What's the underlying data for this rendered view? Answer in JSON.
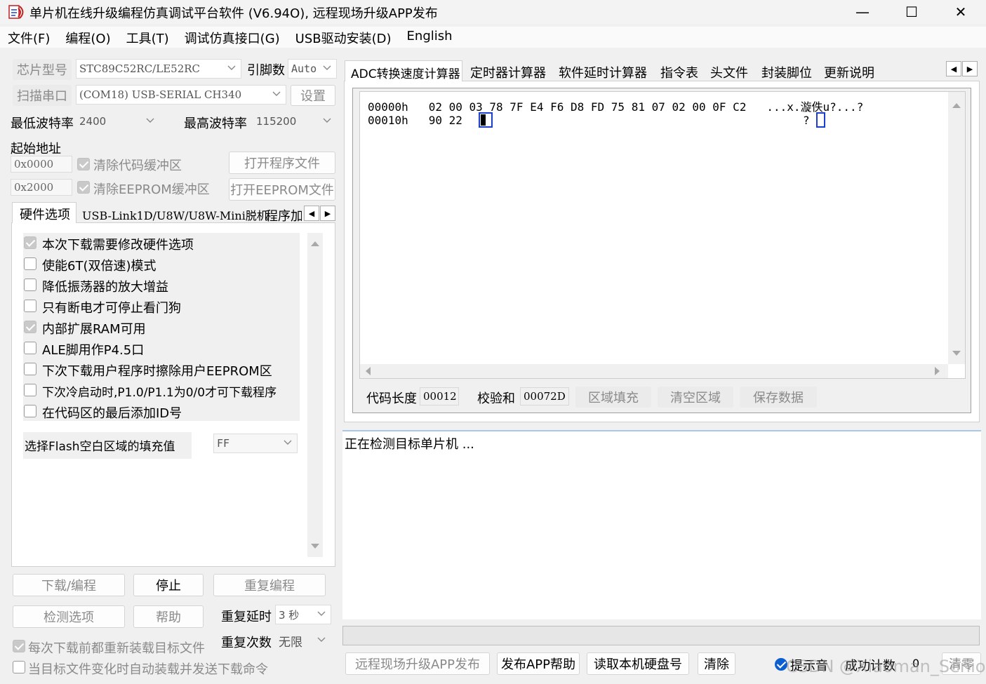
{
  "window": {
    "title": "单片机在线升级编程仿真调试平台软件 (V6.94O), 远程现场升级APP发布",
    "minimize": "—",
    "maximize": "☐",
    "close": "✕",
    "icon": "stc-isp-app-icon"
  },
  "menu": [
    "文件(F)",
    "编程(O)",
    "工具(T)",
    "调试仿真接口(G)",
    "USB驱动安装(D)",
    "English"
  ],
  "left": {
    "chip_label": "芯片型号",
    "chip_value": "STC89C52RC/LE52RC",
    "pins_label": "引脚数",
    "pins_value": "Auto",
    "port_label": "扫描串口",
    "port_value": "(COM18) USB-SERIAL CH340",
    "settings_button": "设置",
    "min_baud_label": "最低波特率",
    "min_baud_value": "2400",
    "max_baud_label": "最高波特率",
    "max_baud_value": "115200",
    "start_addr_label": "起始地址",
    "code_addr": "0x0000",
    "eeprom_addr": "0x2000",
    "clear_code_label": "清除代码缓冲区",
    "clear_eeprom_label": "清除EEPROM缓冲区",
    "open_program_button": "打开程序文件",
    "open_eeprom_button": "打开EEPROM文件",
    "tabs": [
      "硬件选项",
      "USB-Link1D/U8W/U8W-Mini脱机",
      "程序加"
    ],
    "options": [
      {
        "label": "本次下载需要修改硬件选项",
        "checked": true
      },
      {
        "label": "使能6T(双倍速)模式",
        "checked": false
      },
      {
        "label": "降低振荡器的放大增益",
        "checked": false
      },
      {
        "label": "只有断电才可停止看门狗",
        "checked": false
      },
      {
        "label": "内部扩展RAM可用",
        "checked": true
      },
      {
        "label": "ALE脚用作P4.5口",
        "checked": false
      },
      {
        "label": "下次下载用户程序时擦除用户EEPROM区",
        "checked": false
      },
      {
        "label": "下次冷启动时,P1.0/P1.1为0/0才可下载程序",
        "checked": false
      },
      {
        "label": "在代码区的最后添加ID号",
        "checked": false
      }
    ],
    "fill_label": "选择Flash空白区域的填充值",
    "fill_value": "FF",
    "download_button": "下载/编程",
    "stop_button": "停止",
    "reprogram_button": "重复编程",
    "detect_button": "检测选项",
    "help_button": "帮助",
    "repeat_delay_label": "重复延时",
    "repeat_delay_value": "3 秒",
    "repeat_count_label": "重复次数",
    "repeat_count_value": "无限",
    "reload_label": "每次下载前都重新装载目标文件",
    "auto_send_label": "当目标文件变化时自动装载并发送下载命令"
  },
  "right": {
    "tabs": [
      "ADC转换速度计算器",
      "定时器计算器",
      "软件延时计算器",
      "指令表",
      "头文件",
      "封装脚位",
      "更新说明"
    ],
    "hex_rows": [
      {
        "addr": "00000h",
        "bytes": "02 00 03 78 7F E4 F6 D8 FD 75 81 07 02 00 0F C2",
        "ascii": "...x.漩佚u?...?"
      },
      {
        "addr": "00010h",
        "bytes": "90 22",
        "ascii": "?"
      }
    ],
    "code_len_label": "代码长度",
    "code_len_value": "00012",
    "checksum_label": "校验和",
    "checksum_value": "00072D",
    "fill_region_button": "区域填充",
    "clear_region_button": "清空区域",
    "save_data_button": "保存数据",
    "log_text": "正在检测目标单片机 ..."
  },
  "bottom": {
    "remote_button": "远程现场升级APP发布",
    "publish_help_button": "发布APP帮助",
    "read_disk_button": "读取本机硬盘号",
    "clear_button": "清除",
    "sound_label": "提示音",
    "success_count_label": "成功计数",
    "success_count_value": "0",
    "reset_button": "清零",
    "watermark": "CSDN @Xiaoman_Senior"
  },
  "colors": {
    "caret": "#1a3fd0",
    "checkbox_blue": "#0b5fd0",
    "log_border": "#a9c7e8"
  }
}
